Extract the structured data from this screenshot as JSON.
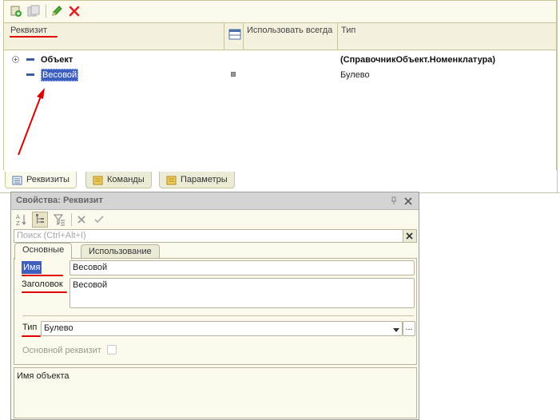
{
  "grid": {
    "columns": {
      "name": "Реквизит",
      "use_always": "Использовать всегда",
      "type": "Тип"
    },
    "rows": [
      {
        "name": "Объект",
        "type": "(СправочникОбъект.Номенклатура)",
        "bold": true
      },
      {
        "name": "Весовой",
        "type": "Булево",
        "selected": true
      }
    ]
  },
  "tabs": [
    {
      "label": "Реквизиты"
    },
    {
      "label": "Команды"
    },
    {
      "label": "Параметры"
    }
  ],
  "properties": {
    "title": "Свойства: Реквизит",
    "search_placeholder": "Поиск (Ctrl+Alt+I)",
    "tabs": [
      "Основные",
      "Использование"
    ],
    "fields": {
      "name_label": "Имя",
      "name_value": "Весовой",
      "caption_label": "Заголовок",
      "caption_value": "Весовой",
      "type_label": "Тип",
      "type_value": "Булево",
      "type_button": "...",
      "main_attr_label": "Основной реквизит"
    },
    "description": "Имя объекта"
  },
  "colors": {
    "panel_bg": "#fbfaed",
    "selection": "#3f5fbf",
    "annotation": "#e00000"
  }
}
